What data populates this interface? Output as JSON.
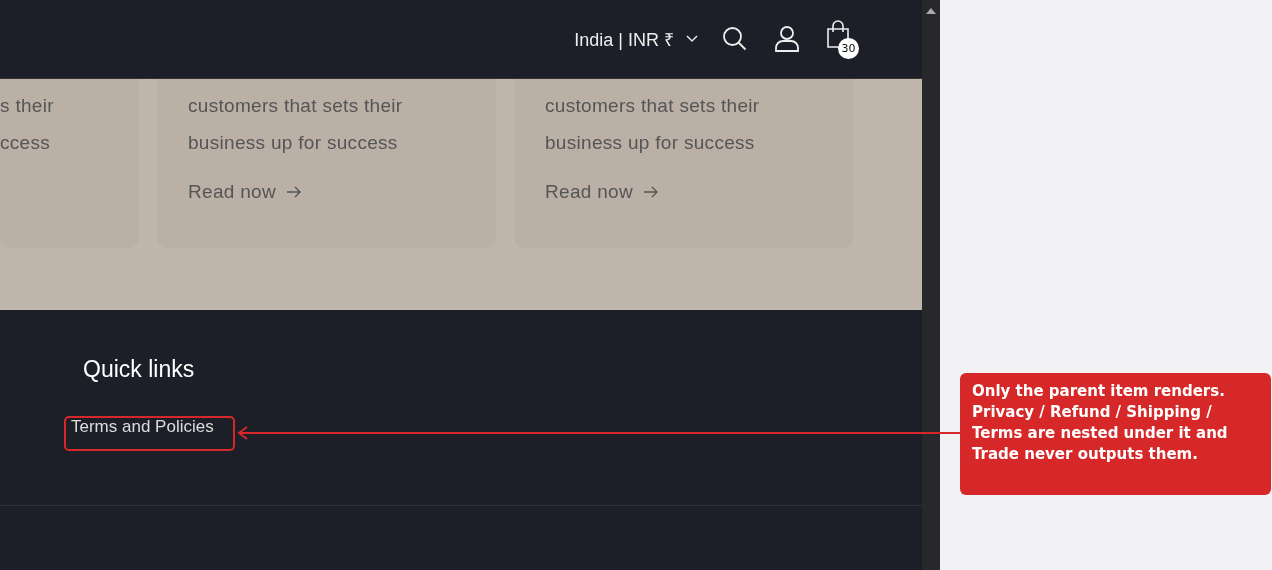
{
  "header": {
    "country_selector": "India | INR ₹",
    "cart_count": "30"
  },
  "cards": [
    {
      "lines": [
        "s their",
        "ccess"
      ]
    },
    {
      "lines": [
        "customers that sets their",
        "business up for success"
      ],
      "link": "Read now"
    },
    {
      "lines": [
        "customers that sets their",
        "business up for success"
      ],
      "link": "Read now"
    }
  ],
  "footer": {
    "heading": "Quick links",
    "links": [
      "Terms and Policies"
    ]
  },
  "annotation": {
    "note": "Only the parent item renders. Privacy / Refund / Shipping / Terms are nested under it and Trade never outputs them."
  }
}
